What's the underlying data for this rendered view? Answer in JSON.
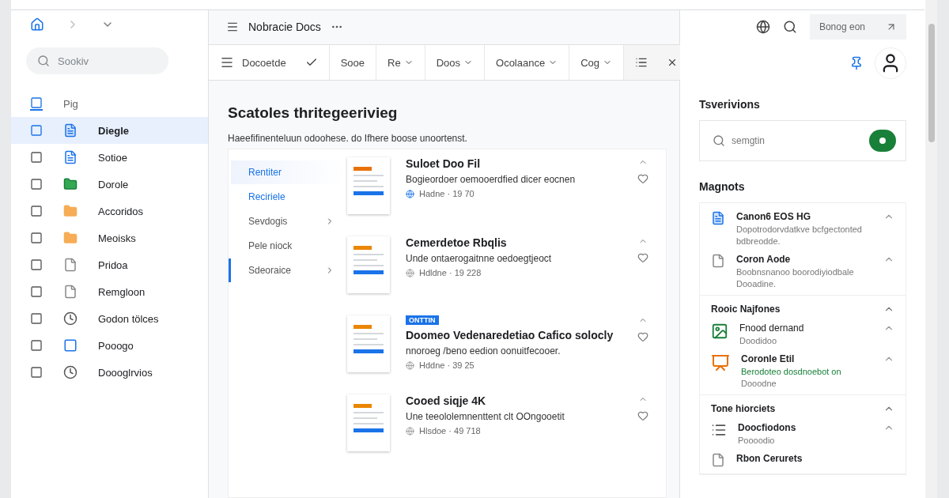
{
  "sidebar": {
    "search": {
      "placeholder": "Sookiv"
    },
    "header_item": {
      "label": "Pig",
      "selected": true
    },
    "items": [
      {
        "label": "Diegle",
        "kind": "doc",
        "selected": true
      },
      {
        "label": "Sotioe",
        "kind": "form",
        "selected": false
      },
      {
        "label": "Dorole",
        "kind": "sheet",
        "selected": false
      },
      {
        "label": "Accoridos",
        "kind": "folder",
        "selected": false
      },
      {
        "label": "Meoisks",
        "kind": "folder",
        "selected": false
      },
      {
        "label": "Pridoa",
        "kind": "page",
        "selected": false
      },
      {
        "label": "Remgloon",
        "kind": "page",
        "selected": false
      },
      {
        "label": "Godon tölces",
        "kind": "clock",
        "selected": false
      },
      {
        "label": "Pooogo",
        "kind": "box",
        "selected": false
      },
      {
        "label": "Doooglrvios",
        "kind": "clock",
        "selected": false
      }
    ]
  },
  "app_bar": {
    "title": "Nobracie Docs",
    "account_button": "Bonog eon"
  },
  "toolbar": {
    "items": [
      {
        "label": "Docoetde",
        "kind": "check"
      },
      {
        "label": "Sooe",
        "kind": "plain"
      },
      {
        "label": "Re",
        "kind": "menu"
      },
      {
        "label": "Doos",
        "kind": "menu"
      },
      {
        "label": "Ocolaance",
        "kind": "menu"
      },
      {
        "label": "Cog",
        "kind": "menu"
      }
    ]
  },
  "heading": "Scatoles thritegeerivieg",
  "intro": "Haeefifinenteluun odoohese. do Ifhere boose unoortenst.",
  "card_nav": [
    {
      "label": "Rentiter",
      "selected": false,
      "kind": "highlight"
    },
    {
      "label": "Reciriele",
      "selected": false,
      "kind": "link"
    },
    {
      "label": "Sevdogis",
      "selected": false,
      "kind": "expandable"
    },
    {
      "label": "Pele niock",
      "selected": false,
      "kind": "plain"
    },
    {
      "label": "Sdeoraice",
      "selected": true,
      "kind": "expandable"
    }
  ],
  "documents": [
    {
      "title": "Suloet Doo Fil",
      "description": "Bogieordoer oemooerdfied dicer eocnen",
      "meta": "Hadne · 19 70",
      "shared": true
    },
    {
      "title": "Cemerdetoe Rbqlis",
      "description": "Unde ontaerogaitnne oedoegtjeoct",
      "meta": "Hdldne · 19 228",
      "shared": false
    },
    {
      "badge": "ONTTIN",
      "title": "Doomeo Vedenaredetiao Cafico solocly",
      "description": "nnoroeg /beno eedion oonuitfecooer.",
      "meta": "Hddne · 39 25",
      "shared": false
    },
    {
      "title": "Cooed siqje 4K",
      "description": "Une teeololemnenttent clt OOngooetit",
      "meta": "Hlsdoe · 49 718",
      "shared": false
    }
  ],
  "right_panel": {
    "title": "Tsverivions",
    "search": {
      "placeholder": "semgtin",
      "on": true
    },
    "list_title": "Magnots",
    "sections": [
      {
        "items": [
          {
            "title": "Canon6 EOS HG",
            "kind": "doc",
            "lines": [
              "Dopotrodorvdatkve bcfgectonted",
              "bdbreodde."
            ]
          },
          {
            "title": "Coron Aode",
            "kind": "page",
            "lines": [
              "Boobnsnanoo boorodiyiodbale",
              "Dooadine."
            ]
          }
        ]
      },
      {
        "title": "Rooic Najfones",
        "items": [
          {
            "title": "Fnood dernand",
            "kind": "image",
            "lines": [
              "Doodidoo"
            ]
          },
          {
            "title": "Coronle Etil",
            "kind": "slides",
            "highlight": "Berodoteo dosdnoebot on",
            "lines": [
              "Dooodne"
            ]
          }
        ]
      },
      {
        "title": "Tone hiorciets",
        "items": [
          {
            "title": "Doocfiodons",
            "kind": "list",
            "lines": [
              "Poooodio"
            ]
          },
          {
            "title": "Rbon Cerurets",
            "kind": "page"
          }
        ]
      }
    ]
  }
}
